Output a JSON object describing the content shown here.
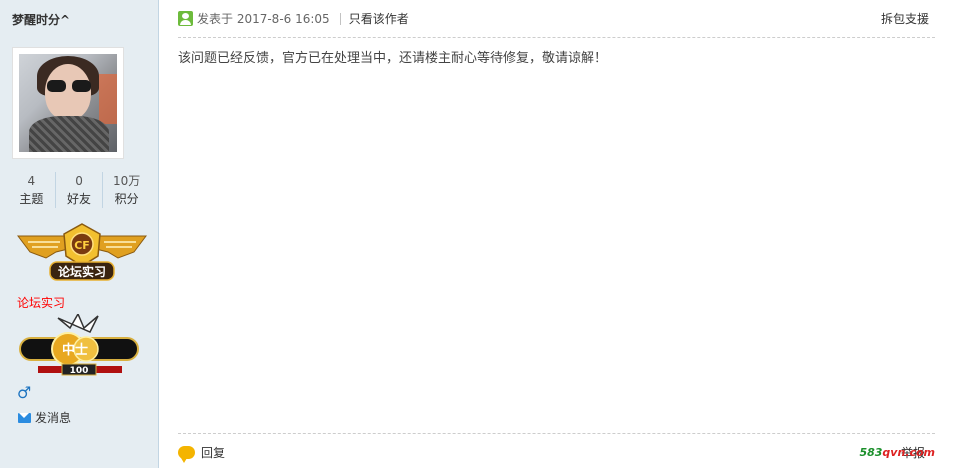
{
  "sidebar": {
    "username": "梦醒时分^",
    "stats": [
      {
        "value": "4",
        "label": "主题"
      },
      {
        "value": "0",
        "label": "好友"
      },
      {
        "value": "10万",
        "label": "积分"
      }
    ],
    "medal_text": "论坛实习",
    "medal_title": "论坛实习",
    "rank_text": "中士",
    "rank_number": "100",
    "send_message": "发消息"
  },
  "post": {
    "posted_at": "发表于 2017-8-6 16:05",
    "only_author": "只看该作者",
    "support": "拆包支援",
    "content": "该问题已经反馈，官方已在处理当中，还请楼主耐心等待修复，敬请谅解！",
    "reply": "回复",
    "report": "举报"
  },
  "watermark": {
    "part1": "583",
    "part2": "qvn.com"
  },
  "colors": {
    "sidebar_bg": "#e5edf2",
    "medal_title": "#ff0000",
    "gender": "#1e74c0"
  }
}
